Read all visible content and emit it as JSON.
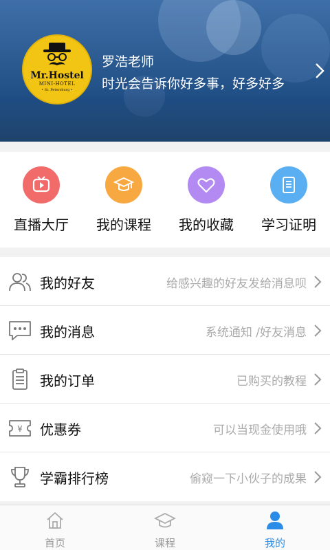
{
  "profile": {
    "name": "罗浩老师",
    "motto": "时光会告诉你好多事，好多好多",
    "avatar_logo": {
      "title": "Mr.Hostel",
      "subtitle": "MINI-HOTEL",
      "location": "• St. Petersburg •"
    }
  },
  "quick_actions": [
    {
      "label": "直播大厅",
      "icon": "live-tv-icon",
      "color": "#f16b6b"
    },
    {
      "label": "我的课程",
      "icon": "graduation-cap-icon",
      "color": "#f7a840"
    },
    {
      "label": "我的收藏",
      "icon": "heart-icon",
      "color": "#b28af2"
    },
    {
      "label": "学习证明",
      "icon": "certificate-icon",
      "color": "#5aaef2"
    }
  ],
  "menu": [
    {
      "title": "我的好友",
      "hint": "给感兴趣的好友发给消息呗",
      "icon": "friends-icon"
    },
    {
      "title": "我的消息",
      "hint": "系统通知 /好友消息",
      "icon": "message-icon"
    },
    {
      "title": "我的订单",
      "hint": "已购买的教程",
      "icon": "order-icon"
    },
    {
      "title": "优惠券",
      "hint": "可以当现金使用哦",
      "icon": "coupon-icon"
    },
    {
      "title": "学霸排行榜",
      "hint": "偷窥一下小伙子的成果",
      "icon": "trophy-icon"
    }
  ],
  "tabs": [
    {
      "label": "首页",
      "icon": "home-icon",
      "active": false
    },
    {
      "label": "课程",
      "icon": "graduation-cap-icon",
      "active": false
    },
    {
      "label": "我的",
      "icon": "person-icon",
      "active": true
    }
  ],
  "colors": {
    "accent": "#2b8ce8",
    "header_blue": "#2d5c93",
    "avatar_yellow": "#f2c414"
  }
}
